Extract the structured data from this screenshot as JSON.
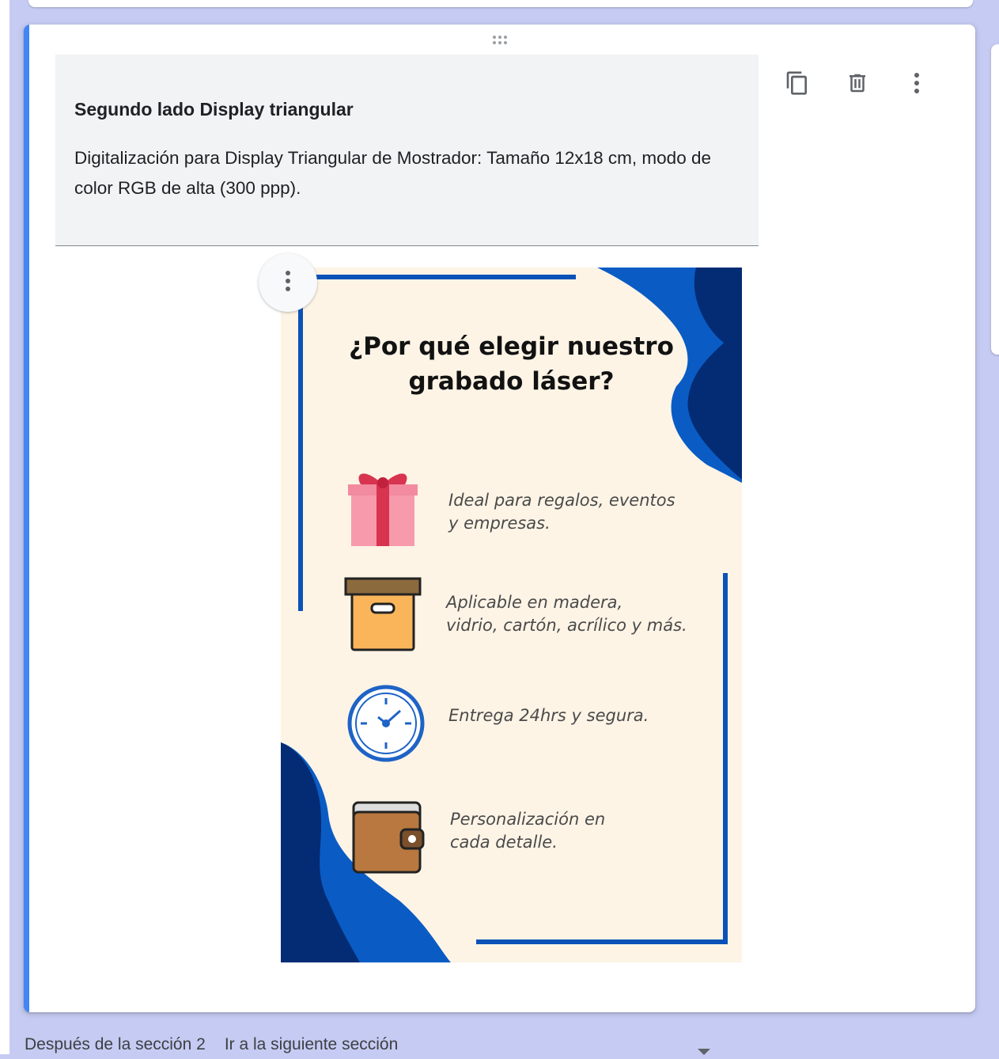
{
  "section": {
    "title": "Segundo lado Display triangular",
    "description": "Digitalización para Display Triangular de Mostrador: Tamaño 12x18 cm, modo de color RGB de alta (300 ppp).",
    "toolbar": {
      "copy_icon": "copy-icon",
      "delete_icon": "trash-icon",
      "more_icon": "more-vert-icon"
    }
  },
  "poster": {
    "title_line1": "¿Por qué elegir nuestro",
    "title_line2": "grabado láser?",
    "features": [
      {
        "icon": "gift-icon",
        "line1": "Ideal para regalos, eventos",
        "line2": "y empresas."
      },
      {
        "icon": "box-icon",
        "line1": "Aplicable en madera,",
        "line2": "vidrio, cartón, acrílico y más."
      },
      {
        "icon": "clock-icon",
        "line1": "Entrega 24hrs y segura.",
        "line2": ""
      },
      {
        "icon": "wallet-icon",
        "line1": "Personalización en",
        "line2": "cada detalle."
      }
    ],
    "colors": {
      "background": "#fdf4e6",
      "dark_blue": "#032c74",
      "blue": "#0a5cc4",
      "frame": "#0b52b8"
    }
  },
  "footer": {
    "label": "Después de la sección 2",
    "select_value": "Ir a la siguiente sección"
  },
  "theme": {
    "accent": "#4285f4",
    "page_bg": "#c6cbf3"
  }
}
